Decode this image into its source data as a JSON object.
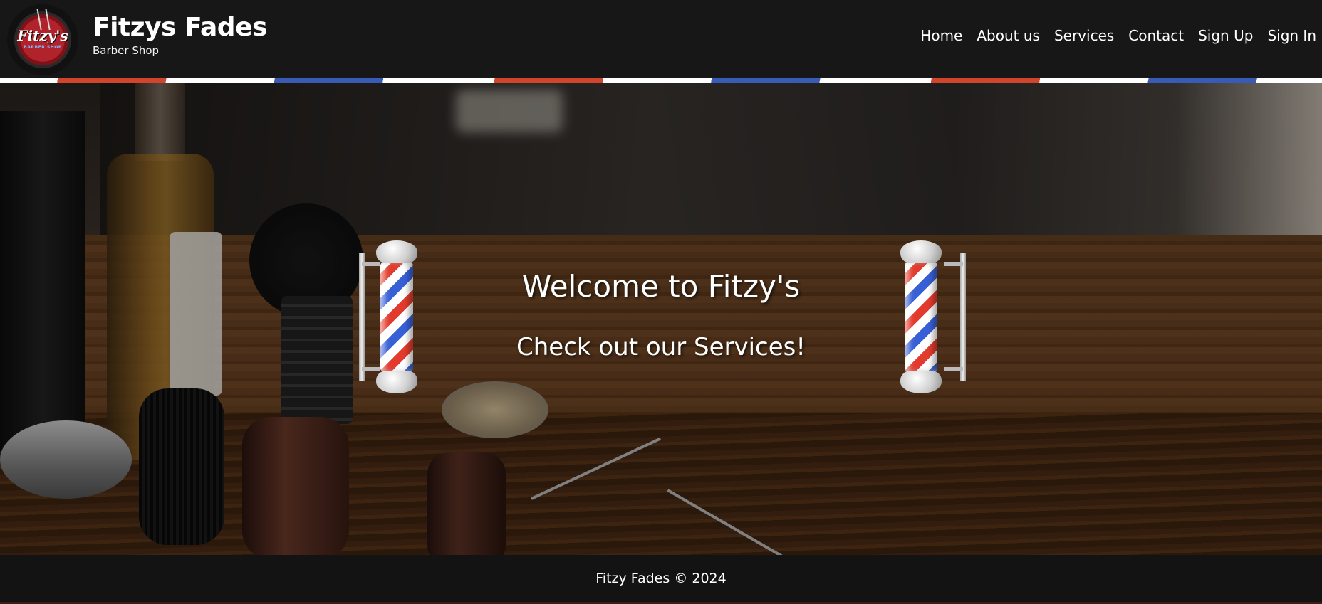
{
  "header": {
    "logo": {
      "text": "Fitzy's",
      "subtext": "BARBER SHOP"
    },
    "brand_title": "Fitzys Fades",
    "brand_subtitle": "Barber Shop"
  },
  "nav": {
    "items": [
      "Home",
      "About us",
      "Services",
      "Contact",
      "Sign Up",
      "Sign In"
    ]
  },
  "hero": {
    "title": "Welcome to Fitzy's",
    "subtitle": "Check out our Services!"
  },
  "footer": {
    "text": "Fitzy Fades © 2024"
  },
  "colors": {
    "header_bg": "#171718",
    "pole_red": "#e23b2e",
    "pole_blue": "#3860d6",
    "text": "#ffffff"
  }
}
